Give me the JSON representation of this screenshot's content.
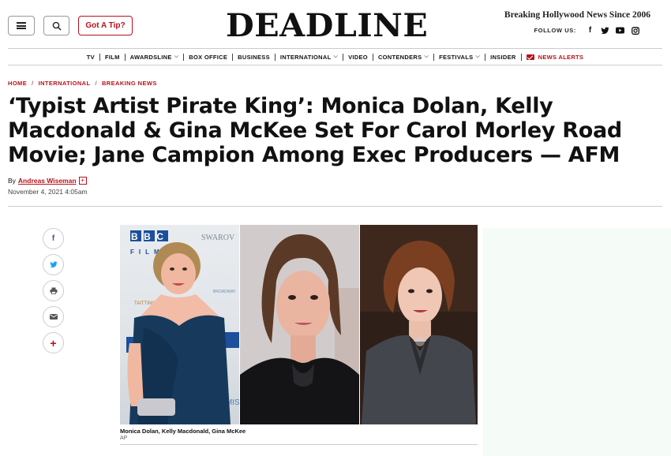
{
  "header": {
    "tip_label": "Got A Tip?",
    "logo": "DEADLINE",
    "tagline": "Breaking Hollywood News Since 2006",
    "follow_label": "FOLLOW US:",
    "social": [
      "f",
      "t",
      "▶",
      "◎"
    ]
  },
  "nav": {
    "items": [
      "TV",
      "FILM",
      "AWARDSLINE",
      "BOX OFFICE",
      "BUSINESS",
      "INTERNATIONAL",
      "VIDEO",
      "CONTENDERS",
      "FESTIVALS",
      "INSIDER"
    ],
    "alerts": "NEWS ALERTS"
  },
  "breadcrumb": [
    "HOME",
    "INTERNATIONAL",
    "BREAKING NEWS"
  ],
  "article": {
    "headline": "‘Typist Artist Pirate King’: Monica Dolan, Kelly Macdonald & Gina McKee Set For Carol Morley Road Movie; Jane Campion Among Exec Producers — AFM",
    "by": "By",
    "author": "Andreas Wiseman",
    "date": "November 4, 2021 4:05am",
    "caption": "Monica Dolan, Kelly Macdonald, Gina McKee",
    "credit": "AP"
  },
  "photo1": {
    "bbc": "BBC",
    "films": "FILMS",
    "swarovski": "SWAROV",
    "taittinger": "TAITTINGER",
    "broadway": "BROADWAY",
    "ermis": "ERMIS"
  },
  "colors": {
    "accent": "#b5121b"
  }
}
